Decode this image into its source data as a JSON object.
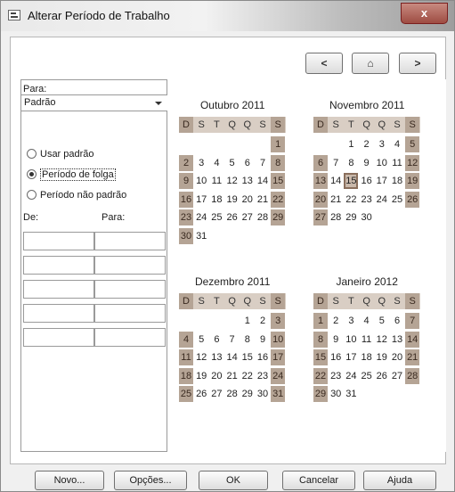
{
  "window": {
    "title": "Alterar Período de Trabalho",
    "close_label": "x"
  },
  "nav": {
    "prev": "<",
    "home": "⌂",
    "next": ">"
  },
  "left": {
    "para_label": "Para:",
    "combo_value": "Padrão",
    "radios": [
      "Usar padrão",
      "Período de folga",
      "Período não padrão"
    ],
    "selected_radio": 1,
    "de_label": "De:",
    "para2_label": "Para:"
  },
  "weekdays": [
    "D",
    "S",
    "T",
    "Q",
    "Q",
    "S",
    "S"
  ],
  "months": [
    {
      "title": "Outubro 2011",
      "start": 6,
      "days": 31,
      "today": null
    },
    {
      "title": "Novembro 2011",
      "start": 2,
      "days": 30,
      "today": 15
    },
    {
      "title": "Dezembro 2011",
      "start": 4,
      "days": 31,
      "today": null
    },
    {
      "title": "Janeiro 2012",
      "start": 0,
      "days": 31,
      "today": null
    }
  ],
  "buttons": {
    "novo": "Novo...",
    "opcoes": "Opções...",
    "ok": "OK",
    "cancelar": "Cancelar",
    "ajuda": "Ajuda"
  }
}
